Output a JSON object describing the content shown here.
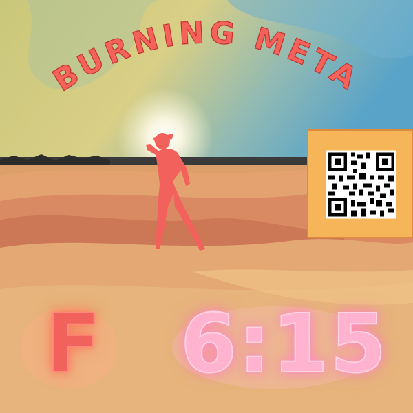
{
  "watchface": {
    "title": "BURNING META",
    "weekday": "F",
    "time": "6:15"
  },
  "colors": {
    "title": "#f4625a",
    "weekday": "#f0625b",
    "time": "#ffb3cf",
    "qr_panel": "#f7b55a",
    "silhouette": "#f2615c"
  }
}
